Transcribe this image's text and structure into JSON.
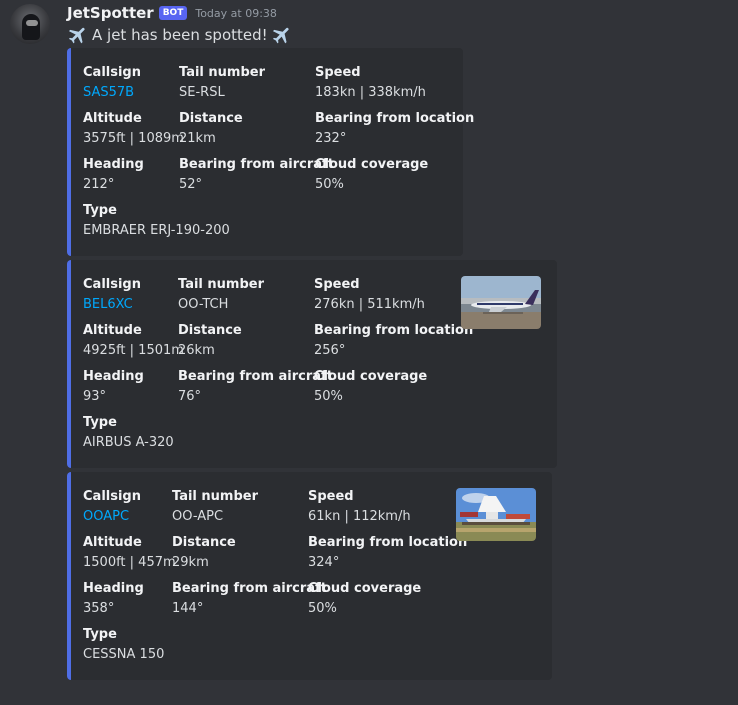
{
  "message": {
    "username": "JetSpotter",
    "bot_tag": "BOT",
    "timestamp": "Today at 09:38",
    "content": "A jet has been spotted!",
    "content_icons": [
      "airplane-icon",
      "airplane-icon"
    ]
  },
  "labels": {
    "callsign": "Callsign",
    "tail_number": "Tail number",
    "speed": "Speed",
    "altitude": "Altitude",
    "distance": "Distance",
    "bearing_from_location": "Bearing from location",
    "heading": "Heading",
    "bearing_from_aircraft": "Bearing from aircraft",
    "cloud_coverage": "Cloud coverage",
    "type": "Type"
  },
  "colors": {
    "embed_accent": "#4f6ee6",
    "link": "#00a8fc",
    "bot_tag": "#5865f2"
  },
  "embeds": [
    {
      "callsign": "SAS57B",
      "tail_number": "SE-RSL",
      "speed": "183kn | 338km/h",
      "altitude": "3575ft | 1089m",
      "distance": "21km",
      "bearing_from_location": "232°",
      "heading": "212°",
      "bearing_from_aircraft": "52°",
      "cloud_coverage": "50%",
      "type": "EMBRAER ERJ-190-200"
    },
    {
      "callsign": "BEL6XC",
      "tail_number": "OO-TCH",
      "speed": "276kn | 511km/h",
      "altitude": "4925ft | 1501m",
      "distance": "26km",
      "bearing_from_location": "256°",
      "heading": "93°",
      "bearing_from_aircraft": "76°",
      "cloud_coverage": "50%",
      "type": "AIRBUS A-320"
    },
    {
      "callsign": "OOAPC",
      "tail_number": "OO-APC",
      "speed": "61kn | 112km/h",
      "altitude": "1500ft | 457m",
      "distance": "29km",
      "bearing_from_location": "324°",
      "heading": "358°",
      "bearing_from_aircraft": "144°",
      "cloud_coverage": "50%",
      "type": "CESSNA 150"
    }
  ]
}
